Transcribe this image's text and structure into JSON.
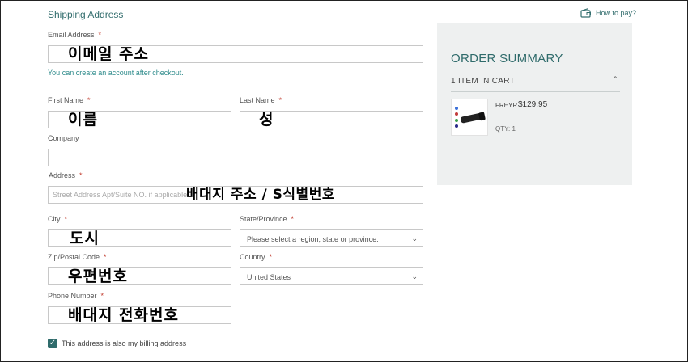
{
  "form": {
    "section_title": "Shipping Address",
    "email": {
      "label": "Email Address",
      "required": "*",
      "overlay": "이메일 주소",
      "note": "You can create an account after checkout."
    },
    "first_name": {
      "label": "First Name",
      "required": "*",
      "overlay": "이름"
    },
    "last_name": {
      "label": "Last Name",
      "required": "*",
      "overlay": "성"
    },
    "company": {
      "label": "Company"
    },
    "address": {
      "label": "Address",
      "required": "*",
      "placeholder": "Street Address Apt/Suite NO. if applicable",
      "overlay": "배대지 주소 / S식별번호"
    },
    "city": {
      "label": "City",
      "required": "*",
      "overlay": "도시"
    },
    "state": {
      "label": "State/Province",
      "required": "*",
      "selected": "Please select a region, state or province."
    },
    "zip": {
      "label": "Zip/Postal Code",
      "required": "*",
      "overlay": "우편번호"
    },
    "country": {
      "label": "Country",
      "required": "*",
      "selected": "United States"
    },
    "phone": {
      "label": "Phone Number",
      "required": "*",
      "overlay": "배대지 전화번호"
    },
    "billing_checkbox": {
      "label": "This address is also my billing address",
      "checked": true
    }
  },
  "how_to_pay": {
    "label": "How to pay?",
    "icon": "wallet-icon"
  },
  "summary": {
    "title": "ORDER SUMMARY",
    "items_in_cart": "1 ITEM IN CART",
    "product": {
      "name": "FREYR",
      "price": "$129.95",
      "qty": "QTY: 1"
    }
  },
  "colors": {
    "accent": "#2f6b6b",
    "required": "#c0392b",
    "summary_bg": "#eef0f0"
  }
}
